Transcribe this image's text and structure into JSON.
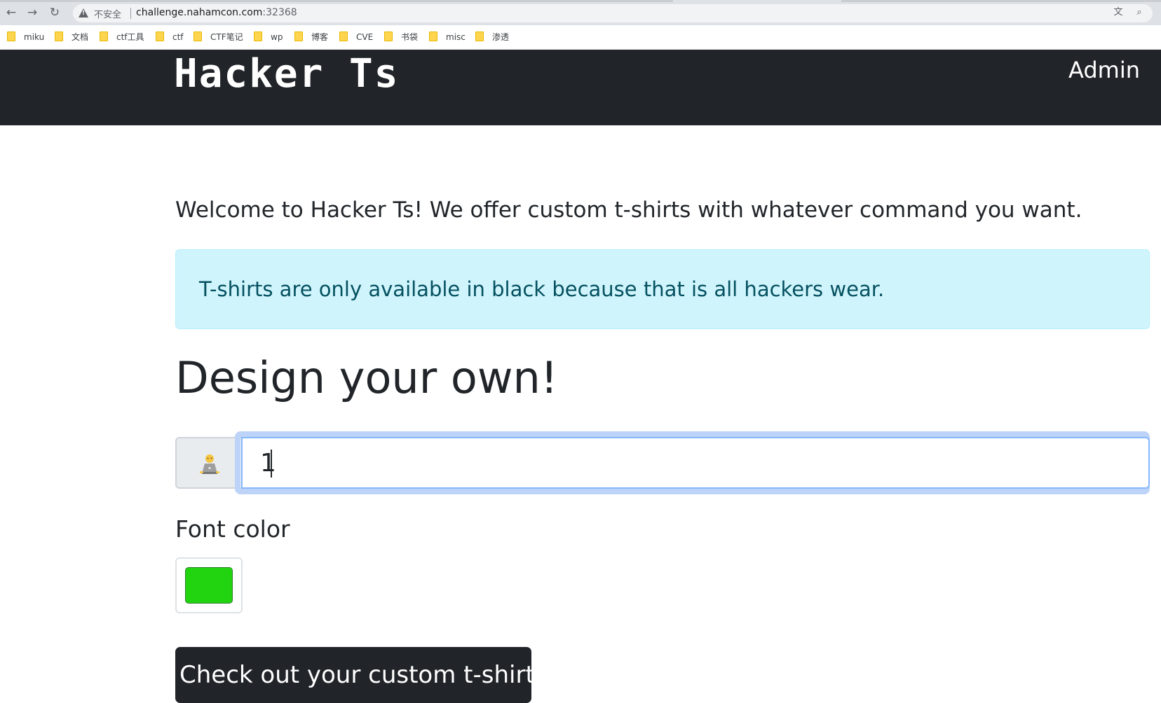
{
  "browser": {
    "security_label": "不安全",
    "url_host": "challenge.nahamcon.com",
    "url_port": ":32368",
    "bookmarks": [
      "miku",
      "文档",
      "ctf工具",
      "ctf",
      "CTF笔记",
      "wp",
      "博客",
      "CVE",
      "书袋",
      "misc",
      "渗透"
    ]
  },
  "site": {
    "brand": "Hacker Ts",
    "admin_link": "Admin",
    "welcome": "Welcome to Hacker Ts! We offer custom t-shirts with whatever command you want.",
    "alert": "T-shirts are only available in black because that is all hackers wear.",
    "heading": "Design your own!",
    "command_value": "1",
    "addon_icon": "hacker-emoji-icon",
    "font_color_label": "Font color",
    "font_color": "#22d40f",
    "submit_label": "Check out your custom t-shirt"
  },
  "colors": {
    "header_bg": "#212529",
    "alert_bg": "#cff4fc",
    "alert_text": "#055160",
    "button_bg": "#212529"
  }
}
